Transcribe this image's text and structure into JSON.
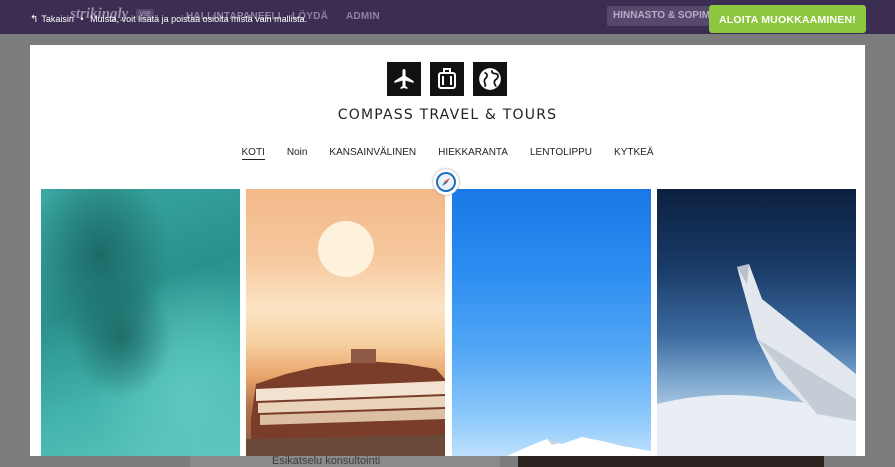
{
  "appbar": {
    "logo": "strikingly",
    "badge": "VIP",
    "nav": [
      "HALLINTAPANEELI",
      "LÖYDÄ",
      "ADMIN"
    ],
    "pricing": "HINNASTO & SOPIMUS"
  },
  "hint": {
    "back_label": "Takaisin",
    "separator": "•",
    "message": "Muista, voit lisätä ja poistaa osioita mistä vain mallista."
  },
  "cta_label": "ALOITA MUOKKAAMINEN!",
  "background": {
    "section_text": "Esikatselu konsultointi"
  },
  "site": {
    "title": "COMPASS TRAVEL & TOURS",
    "icons": [
      "airplane-icon",
      "suitcase-icon",
      "globe-icon"
    ],
    "menu": [
      {
        "label": "KOTI",
        "active": true
      },
      {
        "label": "Noin",
        "active": false
      },
      {
        "label": "KANSAINVÄLINEN",
        "active": false
      },
      {
        "label": "HIEKKARANTA",
        "active": false
      },
      {
        "label": "LENTOLIPPU",
        "active": false
      },
      {
        "label": "KYTKEÄ",
        "active": false
      }
    ],
    "gallery": [
      "ocean-aerial-image",
      "cruise-ship-image",
      "blue-sky-image",
      "airplane-wing-image"
    ]
  },
  "colors": {
    "appbar": "#3c2e52",
    "cta": "#8dc63f",
    "overlay": "#7c7c7c"
  }
}
